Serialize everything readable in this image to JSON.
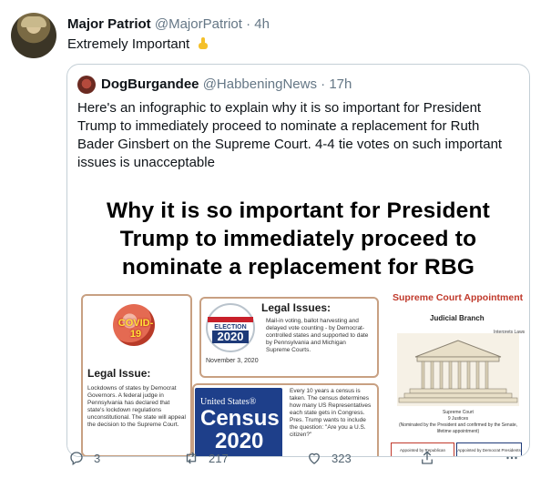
{
  "tweet": {
    "author_name": "Major Patriot",
    "author_handle": "@MajorPatriot",
    "separator": "·",
    "time": "4h",
    "text": "Extremely Important",
    "avatar_icon": "profile-avatar-icon",
    "emoji_icon": "pointing-down-emoji-icon"
  },
  "quote": {
    "author_name": "DogBurgandee",
    "author_handle": "@HabbeningNews",
    "separator": "·",
    "time": "17h",
    "text": "Here's an  infographic to explain why it is so important for President Trump to immediately proceed to nominate a replacement for Ruth Bader Ginsbert on the Supreme Court. 4-4 tie votes on such important issues is unacceptable",
    "infographic": {
      "title": "Why it is so important for President Trump to immediately proceed to nominate a replacement for RBG",
      "panel1": {
        "badge": "COVID-19",
        "heading": "Legal Issue:",
        "body": "Lockdowns of states by Democrat Governors. A federal judge in Pennsylvania has declared that state's lockdown regulations unconstitutional. The state will appeal the decision to the Supreme Court."
      },
      "panel2": {
        "badge_word": "ELECTION",
        "badge_year": "2020",
        "date": "November 3, 2020",
        "heading": "Legal Issues:",
        "body": "Mail-in voting, ballot harvesting and delayed vote counting - by Democrat-controlled states and supported to date by Pennsylvania and Michigan Supreme Courts."
      },
      "panel3": {
        "logo_top": "United States®",
        "logo_word": "Census",
        "logo_year": "2020",
        "body": "Every 10 years a census is taken. The census determines how many US Representatives each state gets in Congress. Pres. Trump wants to include the question: \"Are you a U.S. citizen?\""
      },
      "panel4": {
        "title": "Supreme Court Appointment",
        "branch": "Judicial Branch",
        "note": "Interprets Laws",
        "caption_1": "Supreme Court",
        "caption_2": "9 Justices",
        "caption_3": "(Nominated by the President and confirmed by the Senate, lifetime appointment)",
        "box_left": "Appointed by Republican Presidents",
        "box_right": "Appointed by Democrat Presidents"
      }
    }
  },
  "actions": {
    "reply_count": "3",
    "retweet_count": "217",
    "like_count": "323",
    "icons": [
      "reply-icon",
      "retweet-icon",
      "like-icon",
      "share-icon",
      "more-icon"
    ]
  },
  "colors": {
    "muted_text": "#657786",
    "border": "#c4cfd6",
    "accent_red": "#c0392b",
    "accent_blue": "#1e3f8a"
  }
}
